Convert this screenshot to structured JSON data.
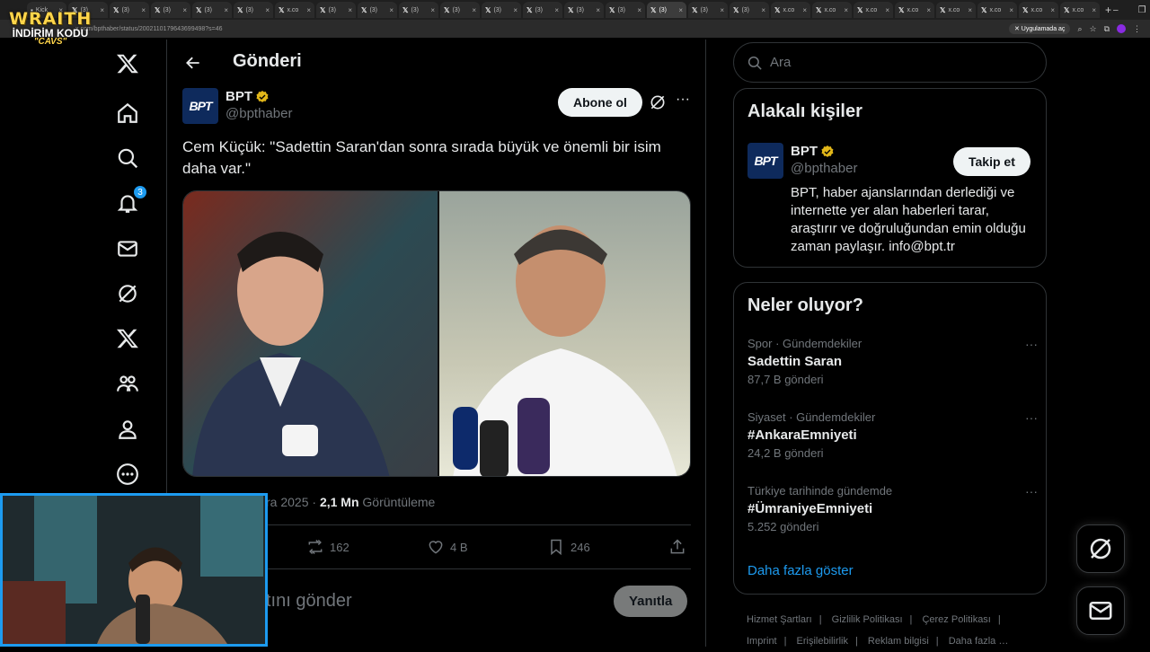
{
  "browser": {
    "tabs": [
      {
        "title": "Kick"
      },
      {
        "title": "(3)"
      },
      {
        "title": "(3)"
      },
      {
        "title": "(3)"
      },
      {
        "title": "(3)"
      },
      {
        "title": "(3)"
      },
      {
        "title": "x.co"
      },
      {
        "title": "(3)"
      },
      {
        "title": "(3)"
      },
      {
        "title": "(3)"
      },
      {
        "title": "(3)"
      },
      {
        "title": "(3)"
      },
      {
        "title": "(3)"
      },
      {
        "title": "(3)"
      },
      {
        "title": "(3)"
      },
      {
        "title": "(3)"
      },
      {
        "title": "(3)"
      },
      {
        "title": "(3)"
      },
      {
        "title": "x.co"
      },
      {
        "title": "x.co"
      },
      {
        "title": "x.co"
      },
      {
        "title": "x.co"
      },
      {
        "title": "x.co"
      },
      {
        "title": "x.co"
      },
      {
        "title": "x.co"
      },
      {
        "title": "x.co"
      }
    ],
    "url": "x.com/bpthaber/status/2002110179643699498?s=46",
    "app_install_label": "Uygulamada aç"
  },
  "overlay": {
    "line1": "WRAITH",
    "line2": "İNDİRİM KODU",
    "line3": "\"CAVS\""
  },
  "sidebar": {
    "notification_count": "3"
  },
  "header": {
    "title": "Gönderi"
  },
  "post": {
    "author_name": "BPT",
    "author_handle": "@bpthaber",
    "avatar_text": "BPT",
    "subscribe_label": "Abone ol",
    "text": "Cem Küçük: \"Sadettin Saran'dan sonra sırada büyük ve önemli bir isim daha var.\"",
    "date_partial": "ra 2025",
    "views_count": "2,1 Mn",
    "views_label": "Görüntüleme",
    "reposts": "162",
    "likes": "4 B",
    "bookmarks": "246",
    "reply_placeholder": "tını gönder",
    "reply_button": "Yanıtla"
  },
  "search": {
    "placeholder": "Ara"
  },
  "related": {
    "title": "Alakalı kişiler",
    "name": "BPT",
    "handle": "@bpthaber",
    "bio": "BPT, haber ajanslarından derlediği ve internette yer alan haberleri tarar, araştırır ve doğruluğundan emin olduğu zaman paylaşır. info@bpt.tr",
    "follow_label": "Takip et"
  },
  "trends": {
    "title": "Neler oluyor?",
    "items": [
      {
        "category": "Spor · Gündemdekiler",
        "name": "Sadettin Saran",
        "count": "87,7 B gönderi"
      },
      {
        "category": "Siyaset · Gündemdekiler",
        "name": "#AnkaraEmniyeti",
        "count": "24,2 B gönderi"
      },
      {
        "category": "Türkiye tarihinde gündemde",
        "name": "#ÜmraniyeEmniyeti",
        "count": "5.252 gönderi"
      }
    ],
    "show_more": "Daha fazla göster"
  },
  "footer": {
    "links": [
      "Hizmet Şartları",
      "Gizlilik Politikası",
      "Çerez Politikası",
      "Imprint",
      "Erişilebilirlik",
      "Reklam bilgisi",
      "Daha fazla …"
    ]
  },
  "colors": {
    "accent": "#1d9bf0",
    "background": "#000000",
    "verified": "#e2b719"
  }
}
